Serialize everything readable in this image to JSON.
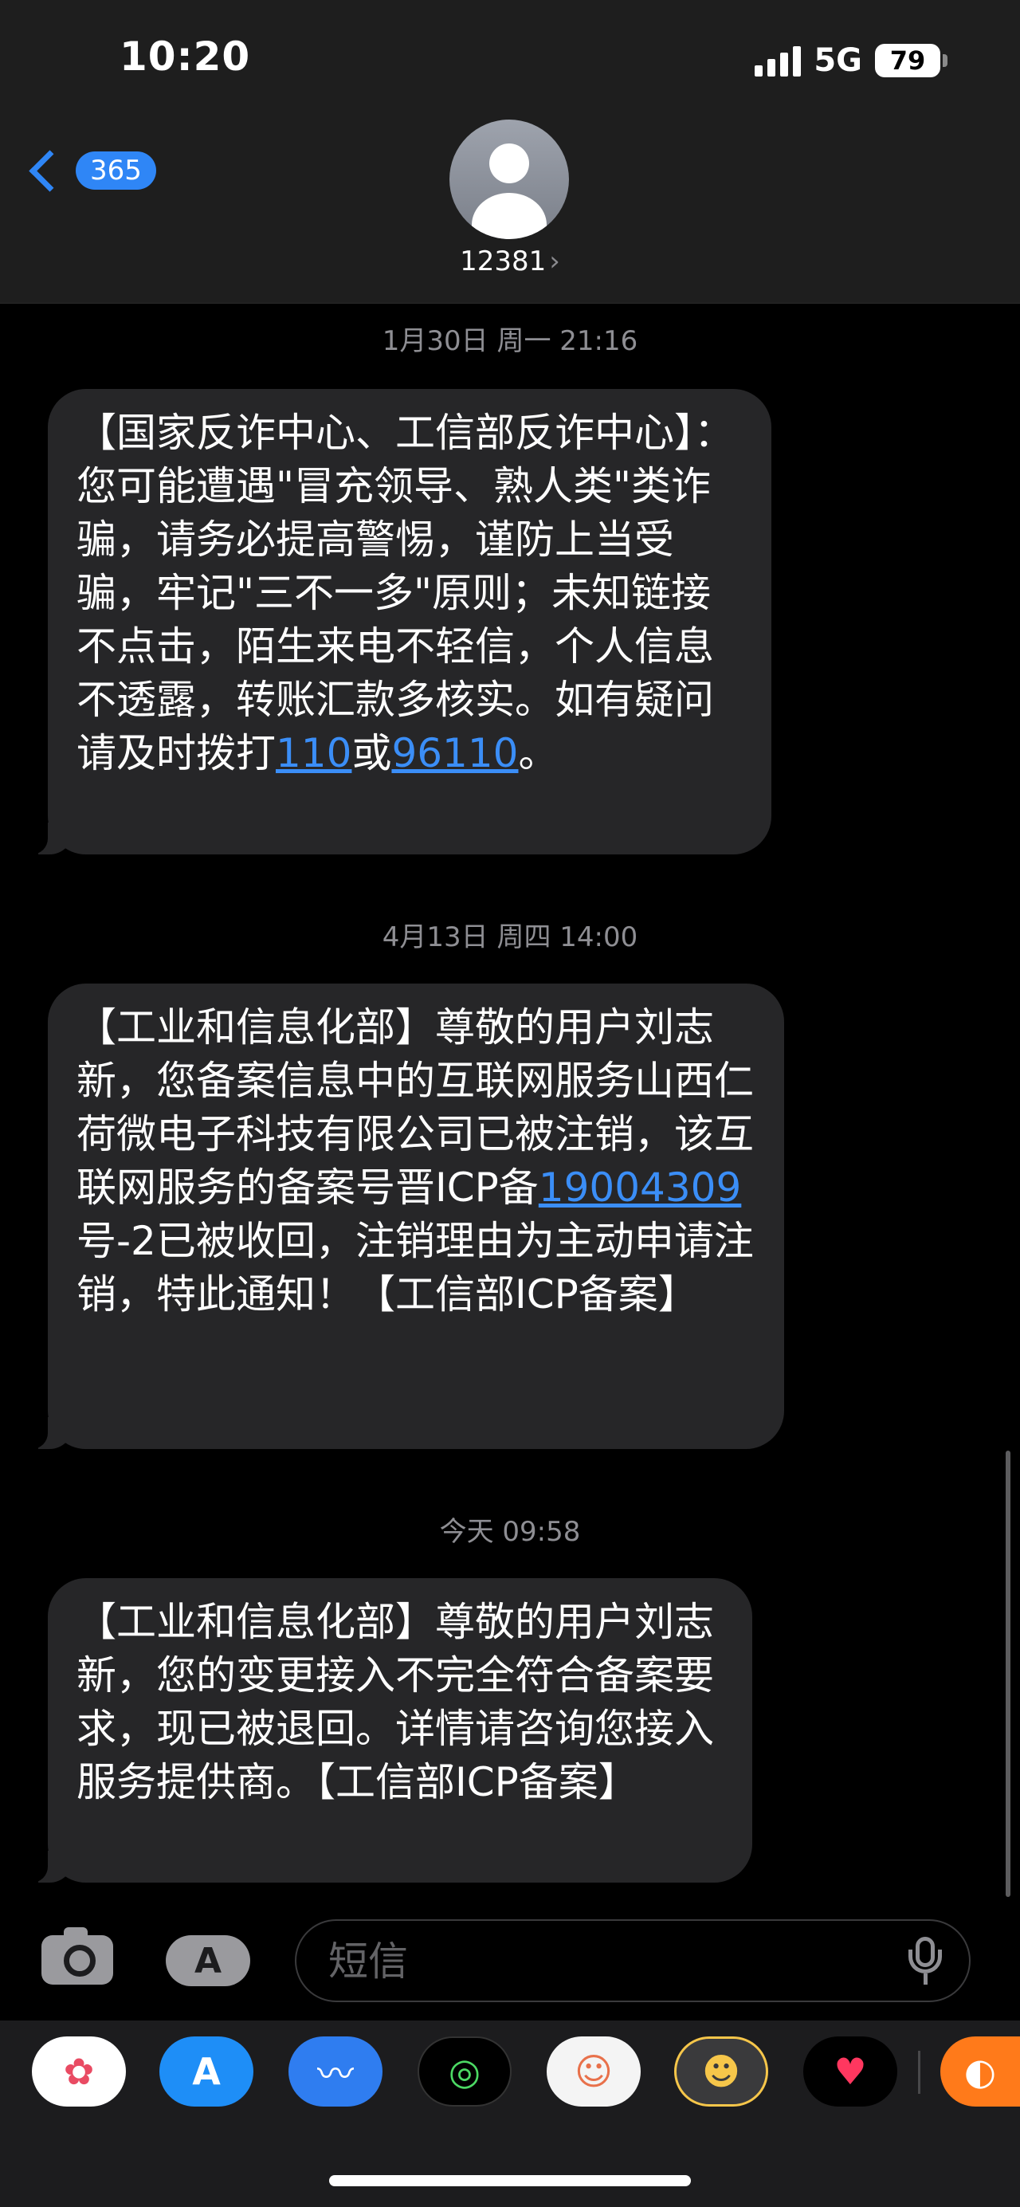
{
  "status_bar": {
    "time": "10:20",
    "network": "5G",
    "battery": "79"
  },
  "nav": {
    "back_count": "365",
    "contact_name": "12381",
    "contact_chevron": "›"
  },
  "messages": [
    {
      "timestamp": "1月30日 周一 21:16",
      "text_before": "【国家反诈中心、工信部反诈中心】：您可能遭遇\"冒充领导、熟人类\"类诈骗，请务必提高警惕，谨防上当受骗，牢记\"三不一多\"原则；未知链接不点击，陌生来电不轻信，个人信息不透露，转账汇款多核实。如有疑问请及时拨打",
      "link1": "110",
      "text_mid": "或",
      "link2": "96110",
      "text_after": "。"
    },
    {
      "timestamp": "4月13日 周四 14:00",
      "text_before": "【工业和信息化部】尊敬的用户刘志新，您备案信息中的互联网服务山西仁荷微电子科技有限公司已被注销，该互联网服务的备案号晋ICP备",
      "link1": "19004309",
      "text_after": "号-2已被收回，注销理由为主动申请注销，特此通知！【工信部ICP备案】"
    },
    {
      "timestamp": "今天 09:58",
      "text": "【工业和信息化部】尊敬的用户刘志新，您的变更接入不完全符合备案要求，现已被退回。详情请咨询您接入服务提供商。【工信部ICP备案】"
    }
  ],
  "compose": {
    "placeholder": "短信",
    "apps_glyph": "A"
  },
  "drawer": {
    "apps": [
      {
        "name": "photos-app",
        "glyph": "✿"
      },
      {
        "name": "app-store-app",
        "glyph": "A"
      },
      {
        "name": "audio-message-app",
        "glyph": "〰"
      },
      {
        "name": "activity-app",
        "glyph": "◎"
      },
      {
        "name": "memoji-stickers-app",
        "glyph": "☺"
      },
      {
        "name": "memoji-app",
        "glyph": "☻"
      },
      {
        "name": "digital-touch-app",
        "glyph": "♥"
      },
      {
        "name": "more-app",
        "glyph": "◐"
      }
    ]
  }
}
